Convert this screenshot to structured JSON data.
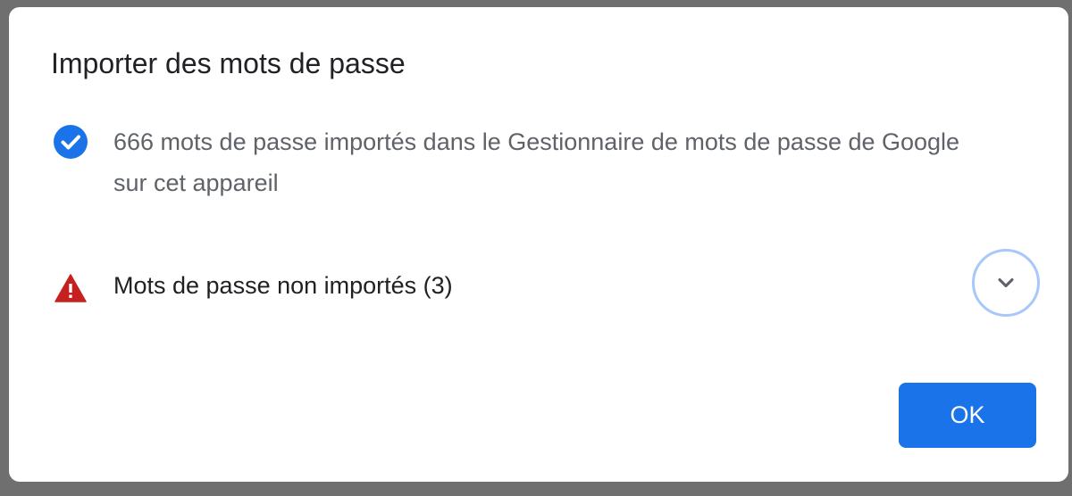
{
  "dialog": {
    "title": "Importer des mots de passe",
    "success": {
      "icon": "check-circle-icon",
      "text": "666 mots de passe importés dans le Gestionnaire de mots de passe de Google sur cet appareil"
    },
    "failed": {
      "icon": "warning-triangle-icon",
      "label": "Mots de passe non importés (3)",
      "expand_icon": "chevron-down-icon"
    },
    "ok_label": "OK"
  },
  "colors": {
    "accent": "#1a73e8",
    "warning": "#c5221f",
    "focus_ring": "#a8c7fa",
    "backdrop": "#6f6f6f"
  }
}
